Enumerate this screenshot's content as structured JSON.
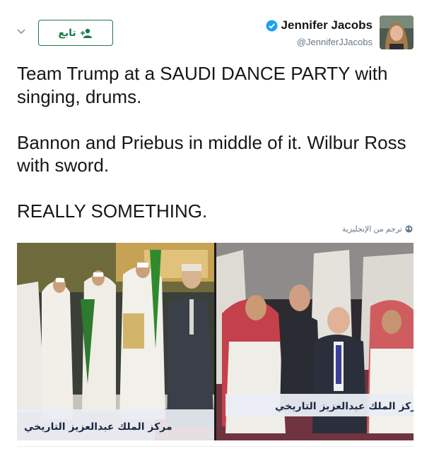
{
  "header": {
    "follow_label": "تابع",
    "author_name": "Jennifer Jacobs",
    "author_handle": "@JenniferJJacobs"
  },
  "tweet": {
    "text": "Team Trump at a SAUDI DANCE PARTY with singing, drums.\n\nBannon and Priebus in middle of it. Wilbur Ross with sword.\n\nREALLY SOMETHING.",
    "translate_label": "ترجم من الإنجليزية"
  },
  "media": {
    "left_caption": "مركز الملك عبدالعزيز التاريخي",
    "right_caption": "مركز الملك عبدالعزيز التاريخي"
  },
  "icons": {
    "chevron": "chevron-down-icon",
    "follow": "person-add-icon",
    "verified": "verified-badge-icon",
    "globe": "globe-icon"
  },
  "colors": {
    "follow_green": "#1b7a46",
    "verified_blue": "#1da1f2",
    "text_primary": "#14171a",
    "text_secondary": "#657786"
  }
}
